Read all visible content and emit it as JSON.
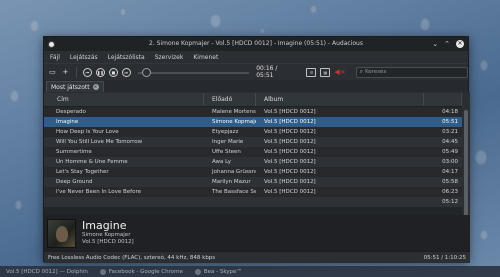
{
  "window": {
    "title": "2. Simone Kopmajer - Vol.5 [HDCD 0012] - Imagine (05:51) - Audacious"
  },
  "menu": [
    "Fájl",
    "Lejátszás",
    "Lejátszólista",
    "Szervizek",
    "Kimenet"
  ],
  "toolbar": {
    "time": "00:16 / 05:51",
    "search_placeholder": "Keresés"
  },
  "tab": {
    "label": "Most játszott"
  },
  "columns": {
    "title": "Cím",
    "artist": "Előadó",
    "album": "Album",
    "length": ""
  },
  "rows": [
    {
      "title": "Desperado",
      "artist": "Malene Mortensen",
      "album": "Vol.5 [HDCD 0012]",
      "length": "04:18",
      "selected": false
    },
    {
      "title": "Imagine",
      "artist": "Simone Kopmajer",
      "album": "Vol.5 [HDCD 0012]",
      "length": "05:51",
      "selected": true
    },
    {
      "title": "How Deep Is Your Love",
      "artist": "Etyepjazz",
      "album": "Vol.5 [HDCD 0012]",
      "length": "03:21",
      "selected": false
    },
    {
      "title": "Will You Still Love Me Tomorrow",
      "artist": "Inger Marie",
      "album": "Vol.5 [HDCD 0012]",
      "length": "04:45",
      "selected": false
    },
    {
      "title": "Summertime",
      "artist": "Uffe Steen",
      "album": "Vol.5 [HDCD 0012]",
      "length": "05:49",
      "selected": false
    },
    {
      "title": "Un Homme & Une Femme",
      "artist": "Awa Ly",
      "album": "Vol.5 [HDCD 0012]",
      "length": "03:00",
      "selected": false
    },
    {
      "title": "Let's Stay Together",
      "artist": "Johanna Grüssner",
      "album": "Vol.5 [HDCD 0012]",
      "length": "04:17",
      "selected": false
    },
    {
      "title": "Deep Ground",
      "artist": "Marilyn Mazur",
      "album": "Vol.5 [HDCD 0012]",
      "length": "05:58",
      "selected": false
    },
    {
      "title": "I've Never Been In Love Before",
      "artist": "The Bassface Swing Trio",
      "album": "Vol.5 [HDCD 0012]",
      "length": "06:23",
      "selected": false
    },
    {
      "title": "",
      "artist": "",
      "album": "",
      "length": "05:12",
      "selected": false
    }
  ],
  "now_playing": {
    "title": "Imagine",
    "artist": "Simone Kopmajer",
    "album": "Vol.5 [HDCD 0012]"
  },
  "status": {
    "codec": "Free Lossless Audio Codec (FLAC), sztereó, 44 kHz, 848 kbps",
    "time": "05:51 / 1:10:25"
  },
  "taskbar": [
    {
      "label": "Vol.5 [HDCD 0012] — Dolphin"
    },
    {
      "label": "Facebook - Google Chrome"
    },
    {
      "label": "Bea - Skype™"
    }
  ]
}
